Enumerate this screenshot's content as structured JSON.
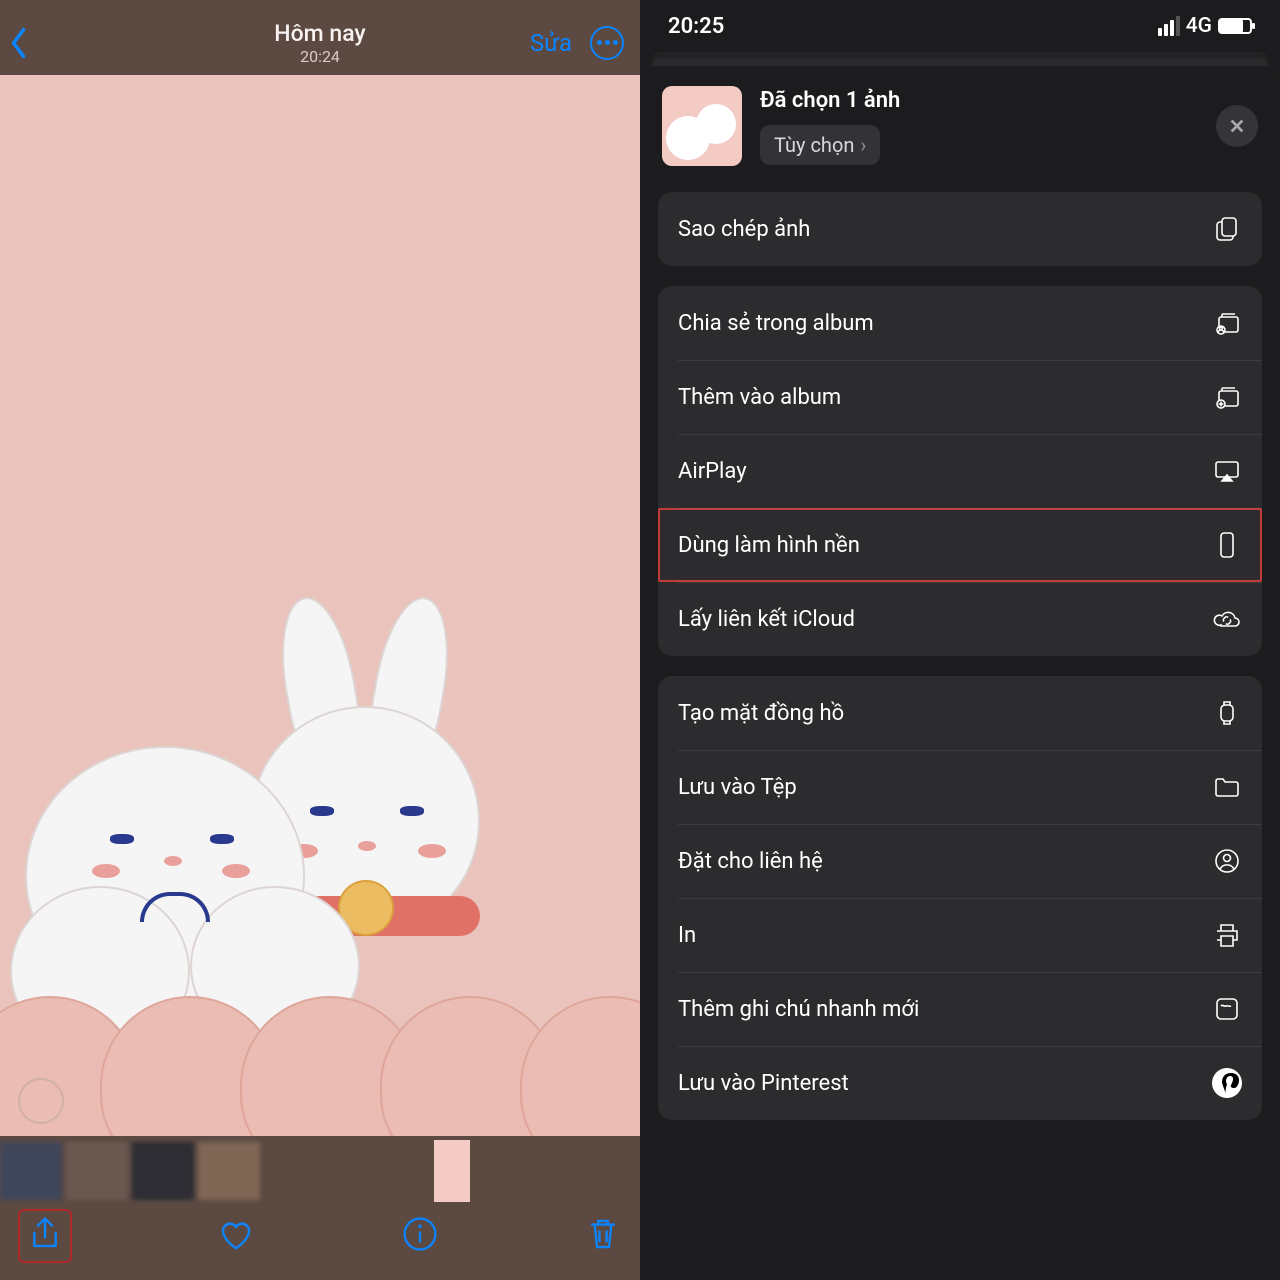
{
  "left": {
    "header": {
      "title": "Hôm nay",
      "time": "20:24",
      "edit": "Sửa"
    }
  },
  "right": {
    "status": {
      "time": "20:25",
      "network": "4G"
    },
    "sheet": {
      "title": "Đã chọn 1 ảnh",
      "options_label": "Tùy chọn"
    },
    "group1": {
      "copy": "Sao chép ảnh"
    },
    "group2": {
      "share_album": "Chia sẻ trong album",
      "add_album": "Thêm vào album",
      "airplay": "AirPlay",
      "wallpaper": "Dùng làm hình nền",
      "icloud": "Lấy liên kết iCloud"
    },
    "group3": {
      "watchface": "Tạo mặt đồng hồ",
      "save_files": "Lưu vào Tệp",
      "contact": "Đặt cho liên hệ",
      "print": "In",
      "quicknote": "Thêm ghi chú nhanh mới",
      "pinterest": "Lưu vào Pinterest"
    }
  }
}
